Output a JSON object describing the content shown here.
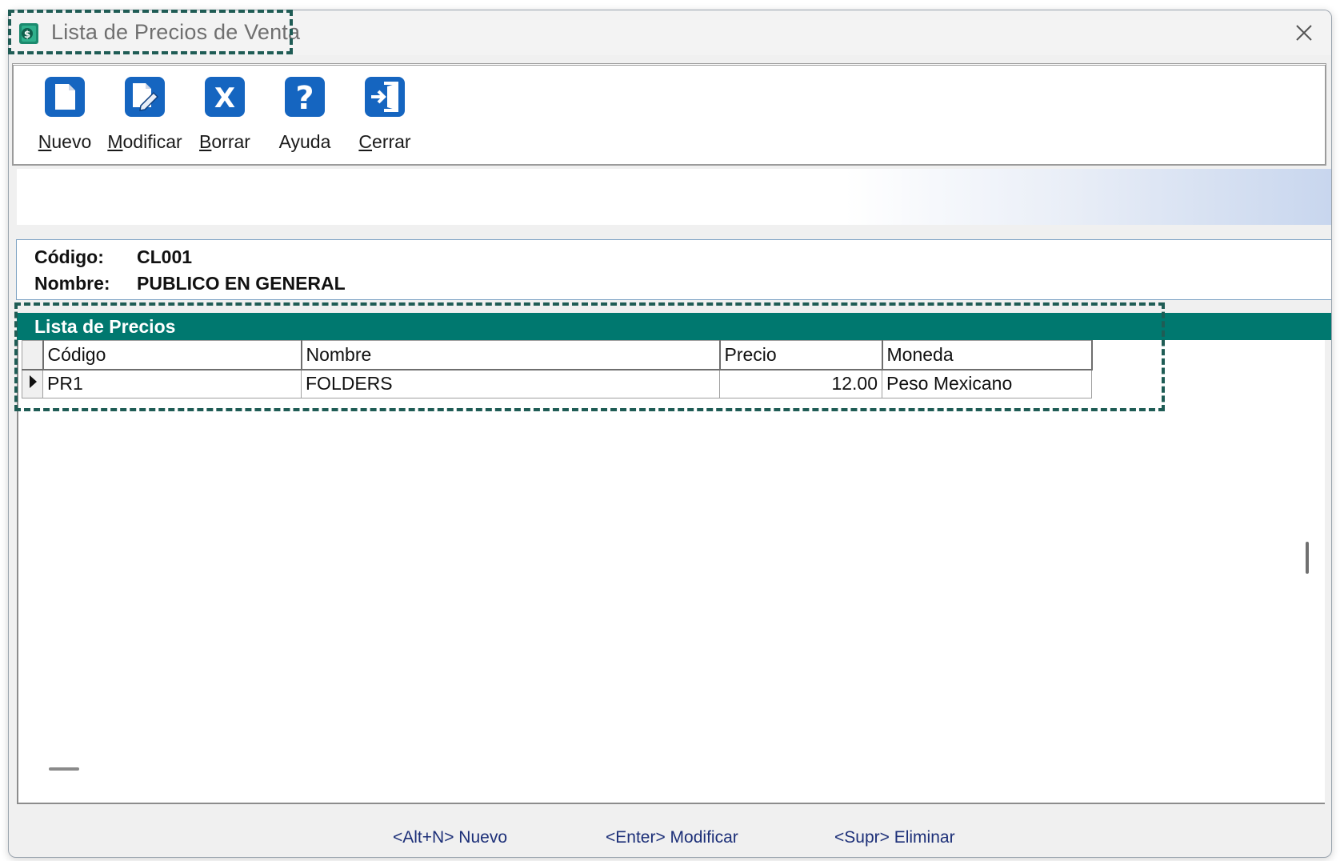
{
  "window": {
    "title": "Lista de Precios de Venta",
    "icon": "price-list-app-icon",
    "close_icon": "close-icon"
  },
  "toolbar": {
    "buttons": [
      {
        "label_u": "N",
        "label_rest": "uevo",
        "icon": "new-document-icon"
      },
      {
        "label_u": "M",
        "label_rest": "odificar",
        "icon": "edit-document-icon"
      },
      {
        "label_u": "B",
        "label_rest": "orrar",
        "icon": "delete-x-icon"
      },
      {
        "label_pre": "Ayuda",
        "icon": "help-question-icon"
      },
      {
        "label_u": "C",
        "label_rest": "errar",
        "icon": "exit-door-icon"
      }
    ]
  },
  "info": {
    "codigo_label": "Código:",
    "codigo_value": "CL001",
    "nombre_label": "Nombre:",
    "nombre_value": "PUBLICO EN GENERAL"
  },
  "section": {
    "title": "Lista de Precios"
  },
  "grid": {
    "columns": [
      "Código",
      "Nombre",
      "Precio",
      "Moneda"
    ],
    "rows": [
      {
        "codigo": "PR1",
        "nombre": "FOLDERS",
        "precio": "12.00",
        "moneda": "Peso Mexicano"
      }
    ]
  },
  "status": {
    "hint_new": "<Alt+N> Nuevo",
    "hint_edit": "<Enter> Modificar",
    "hint_delete": "<Supr> Eliminar"
  },
  "colors": {
    "accent_teal": "#00786f",
    "toolbar_icon_blue": "#1565c0",
    "hint_text": "#1c2f78",
    "dashed_highlight": "#1f5c55"
  }
}
